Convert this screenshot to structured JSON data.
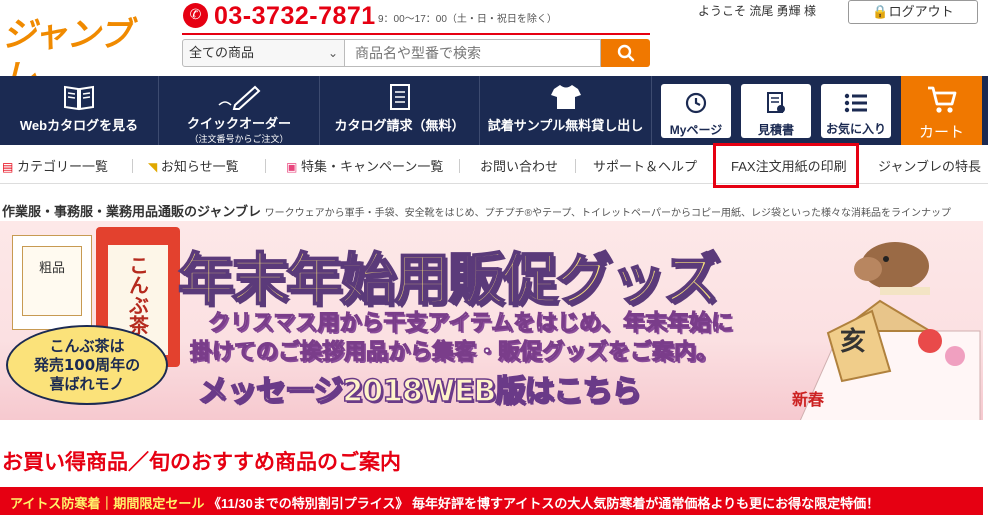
{
  "header": {
    "logo_text": "ジャンブレ",
    "phone_number": "03-3732-7871",
    "phone_hours": "9：00〜17：00（土・日・祝日を除く）",
    "welcome": "ようこそ 流尾 勇輝 様",
    "logout_label": "ログアウト",
    "search": {
      "category_value": "全ての商品",
      "placeholder": "商品名や型番で検索"
    }
  },
  "nav": {
    "items": [
      {
        "label": "Webカタログを見る",
        "icon": "book-icon"
      },
      {
        "label": "クイックオーダー",
        "sub": "（注文番号からご注文）",
        "icon": "pencil-icon"
      },
      {
        "label": "カタログ請求（無料）",
        "icon": "document-icon"
      },
      {
        "label": "試着サンプル無料貸し出し",
        "icon": "tshirt-icon"
      }
    ],
    "boxes": [
      {
        "label": "Myページ",
        "icon": "clock-icon"
      },
      {
        "label": "見積書",
        "icon": "quote-icon"
      },
      {
        "label": "お気に入り",
        "icon": "list-icon"
      }
    ],
    "cart_label": "カート"
  },
  "subnav": {
    "items": [
      {
        "label": "カテゴリー一覧"
      },
      {
        "label": "お知らせ一覧"
      },
      {
        "label": "特集・キャンペーン一覧"
      },
      {
        "label": "お問い合わせ"
      },
      {
        "label": "サポート＆ヘルプ"
      },
      {
        "label": "FAX注文用紙の印刷"
      },
      {
        "label": "ジャンブレの特長"
      }
    ]
  },
  "tagline": {
    "main": "作業服・事務服・業務用品通販のジャンブレ",
    "sub": "ワークウェアから軍手・手袋、安全靴をはじめ、プチプチ®やテープ、トイレットペーパーからコピー用紙、レジ袋といった様々な消耗品をラインナップ"
  },
  "banner": {
    "title": "年末年始用販促グッズ",
    "line1": "クリスマス用から干支アイテムをはじめ、年末年始に",
    "line2": "掛けてのご挨拶用品から集客・販促グッズをご案内。",
    "message": "メッセージ2018WEB版はこちら",
    "badge": [
      "こんぶ茶は",
      "発売100周年の",
      "喜ばれモノ"
    ],
    "tea_label": "こんぶ茶",
    "gift_label": "粗品",
    "ema_label": "亥",
    "new_year_label": "新春"
  },
  "section": {
    "title": "お買い得商品／旬のおすすめ商品のご案内",
    "sale_highlight": "アイトス防寒着｜期間限定セール",
    "sale_text": "《11/30までの特別割引プライス》 毎年好評を博すアイトスの大人気防寒着が通常価格よりも更にお得な限定特価！"
  },
  "colors": {
    "brand_orange": "#f07800",
    "brand_red": "#e60012",
    "navy": "#1b2a52"
  }
}
